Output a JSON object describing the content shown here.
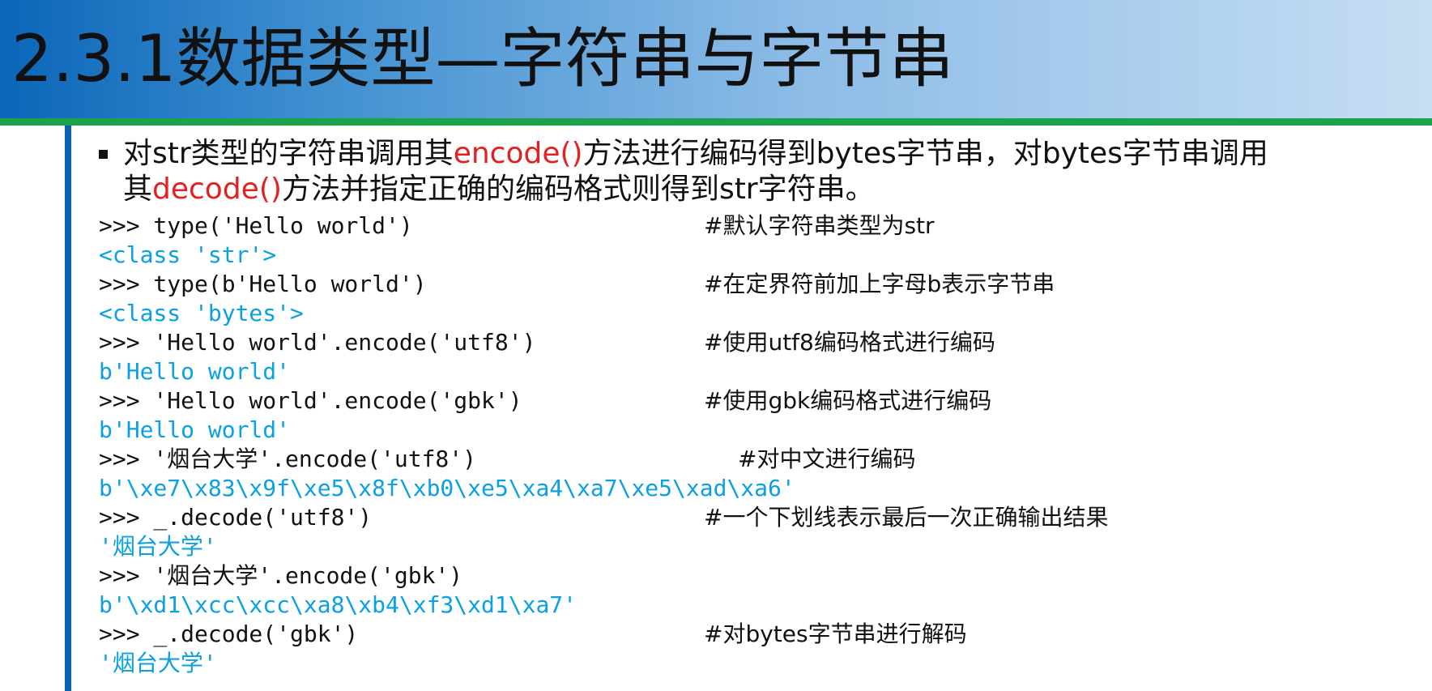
{
  "slide": {
    "title": "2.3.1数据类型—字符串与字节串",
    "bullet": {
      "line1_a": "对str类型的字符串调用其",
      "line1_b": "encode()",
      "line1_c": "方法进行编码得到bytes字节串，对bytes字节串调用",
      "line2_a": "其",
      "line2_b": "decode()",
      "line2_c": "方法并指定正确的编码格式则得到str字符串。"
    },
    "code": [
      {
        "text": ">>> type('Hello world')",
        "comment": "#默认字符串类型为str"
      },
      {
        "text": "<class 'str'>"
      },
      {
        "text": ">>> type(b'Hello world')",
        "comment": "#在定界符前加上字母b表示字节串"
      },
      {
        "text": "<class 'bytes'>"
      },
      {
        "text": ">>> 'Hello world'.encode('utf8')",
        "comment": "#使用utf8编码格式进行编码"
      },
      {
        "text": "b'Hello world'"
      },
      {
        "text": ">>> 'Hello world'.encode('gbk')",
        "comment": "#使用gbk编码格式进行编码"
      },
      {
        "text": "b'Hello world'"
      },
      {
        "text": ">>> '烟台大学'.encode('utf8')",
        "comment": "#对中文进行编码"
      },
      {
        "text": "b'\\xe7\\x83\\x9f\\xe5\\x8f\\xb0\\xe5\\xa4\\xa7\\xe5\\xad\\xa6'"
      },
      {
        "text": ">>> _.decode('utf8')",
        "comment": "#一个下划线表示最后一次正确输出结果"
      },
      {
        "text": "'烟台大学'"
      },
      {
        "text": ">>> '烟台大学'.encode('gbk')"
      },
      {
        "text": "b'\\xd1\\xcc\\xcc\\xa8\\xb4\\xf3\\xd1\\xa7'"
      },
      {
        "text": ">>> _.decode('gbk')",
        "comment": "#对bytes字节串进行解码"
      },
      {
        "text": "'烟台大学'"
      }
    ],
    "colors": {
      "title_gradient_start": "#0b66b8",
      "title_gradient_end": "#c7def3",
      "rule_green": "#1aa34a",
      "rule_blue": "#0b62b3",
      "highlight_red": "#e32121",
      "output_blue": "#0aa0e3"
    }
  }
}
